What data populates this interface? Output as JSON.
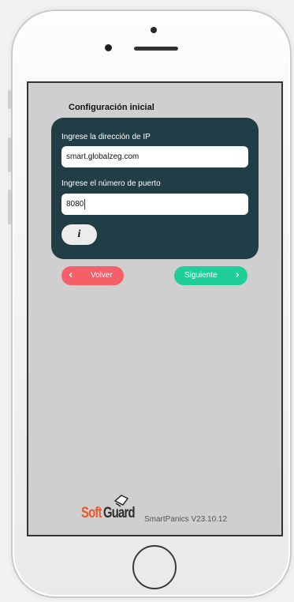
{
  "screen": {
    "title": "Configuración inicial",
    "ip_label": "Ingrese la dirección de IP",
    "ip_value": "smart.globalzeg.com",
    "port_label": "Ingrese el número de puerto",
    "port_value": "8080",
    "info_glyph": "i",
    "back_label": "Volver",
    "next_label": "Siguiente",
    "back_chevron": "‹",
    "next_chevron": "›"
  },
  "footer": {
    "logo_soft": "Soft",
    "logo_guard": "Guard",
    "version": "SmartPanics V23.10.12"
  },
  "colors": {
    "card": "#213d45",
    "back_button": "#f55f68",
    "next_button": "#1ecf97",
    "screen_bg": "#cfcfcf",
    "logo_orange": "#e85a2a"
  },
  "icons": {
    "info": "info-icon",
    "back": "chevron-left-icon",
    "next": "chevron-right-icon",
    "logo_mark": "shield-logo-icon"
  }
}
